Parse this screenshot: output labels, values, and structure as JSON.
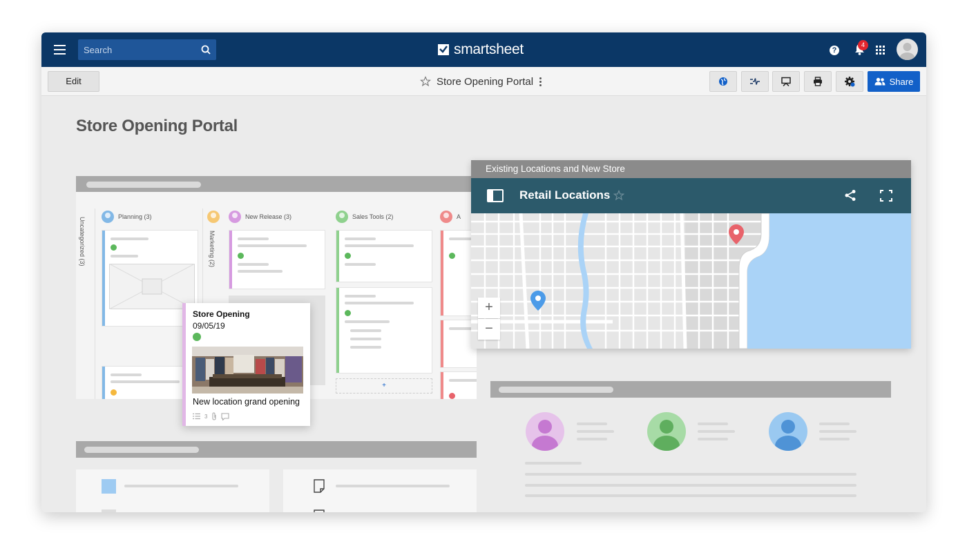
{
  "app": {
    "brand": "smartsheet",
    "search_placeholder": "Search",
    "notification_count": "4",
    "help_glyph": "?"
  },
  "toolbar": {
    "edit_label": "Edit",
    "sheet_title": "Store Opening Portal",
    "share_label": "Share",
    "icons": [
      "globe-icon",
      "activity-log-icon",
      "presentation-icon",
      "print-icon",
      "settings-gear-icon"
    ]
  },
  "page": {
    "title": "Store Opening Portal"
  },
  "board": {
    "columns": [
      {
        "label": "Uncategorized (3)",
        "color": "#b0b0b0",
        "vertical": true
      },
      {
        "label": "Planning (3)",
        "color": "#82b8e6"
      },
      {
        "label": "Marketing (2)",
        "color": "#f6c873",
        "vertical": true
      },
      {
        "label": "New Release (3)",
        "color": "#d69ae0"
      },
      {
        "label": "Sales Tools (2)",
        "color": "#8fd18e"
      },
      {
        "label": "A",
        "color": "#ef8a8a"
      }
    ]
  },
  "popup_card": {
    "title": "Store Opening",
    "date": "09/05/19",
    "description": "New location grand opening",
    "subtask_count": "3",
    "status_color": "#5cb85c"
  },
  "map_widget": {
    "header": "Existing Locations and New Store",
    "title": "Retail Locations",
    "zoom_in": "+",
    "zoom_out": "−"
  },
  "colors": {
    "topbar": "#0b3766",
    "share_button": "#1260c8",
    "map_bar": "#2c5a6b",
    "water": "#aad3f7",
    "pin_red": "#e8636b",
    "pin_blue": "#4c9be8"
  },
  "people_colors": [
    "#d69ae0",
    "#8fd18e",
    "#82b8e6"
  ]
}
